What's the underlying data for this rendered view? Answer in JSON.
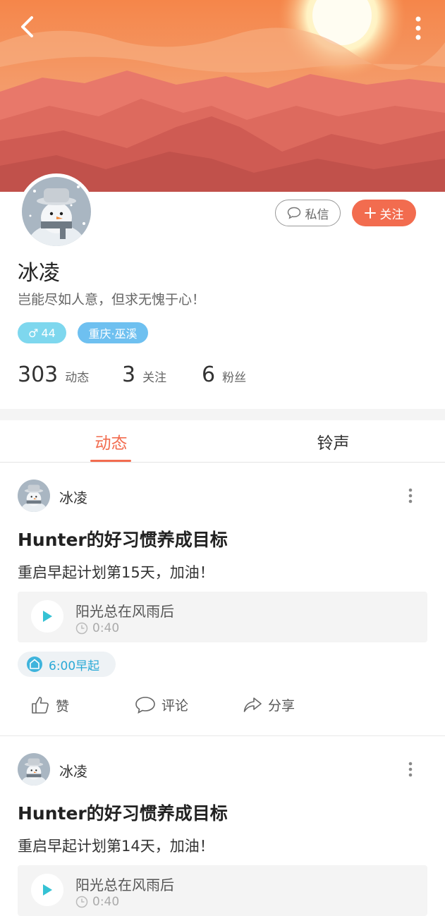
{
  "header": {
    "back_icon": "chevron-left-icon",
    "more_icon": "more-vertical-icon"
  },
  "profile": {
    "name": "冰凌",
    "bio": "岂能尽如人意，但求无愧于心！",
    "gender_symbol": "♂",
    "age": "44",
    "location": "重庆·巫溪",
    "message_label": "私信",
    "follow_label": "关注"
  },
  "stats": {
    "posts": {
      "value": "303",
      "label": "动态"
    },
    "following": {
      "value": "3",
      "label": "关注"
    },
    "followers": {
      "value": "6",
      "label": "粉丝"
    }
  },
  "tabs": {
    "activity": "动态",
    "ringtones": "铃声"
  },
  "posts": [
    {
      "user": "冰凌",
      "title": "Hunter的好习惯养成目标",
      "text": "重启早起计划第15天，加油！",
      "audio_title": "阳光总在风雨后",
      "audio_duration": "0:40",
      "goal": "6:00早起",
      "like": "赞",
      "comment": "评论",
      "share": "分享"
    },
    {
      "user": "冰凌",
      "title": "Hunter的好习惯养成目标",
      "text": "重启早起计划第14天，加油！",
      "audio_title": "阳光总在风雨后",
      "audio_duration": "0:40"
    }
  ],
  "colors": {
    "accent": "#f26c4f",
    "age_tag": "#7ed7ee",
    "location_tag": "#6ec0f0",
    "goal_text": "#2aa9d6"
  }
}
